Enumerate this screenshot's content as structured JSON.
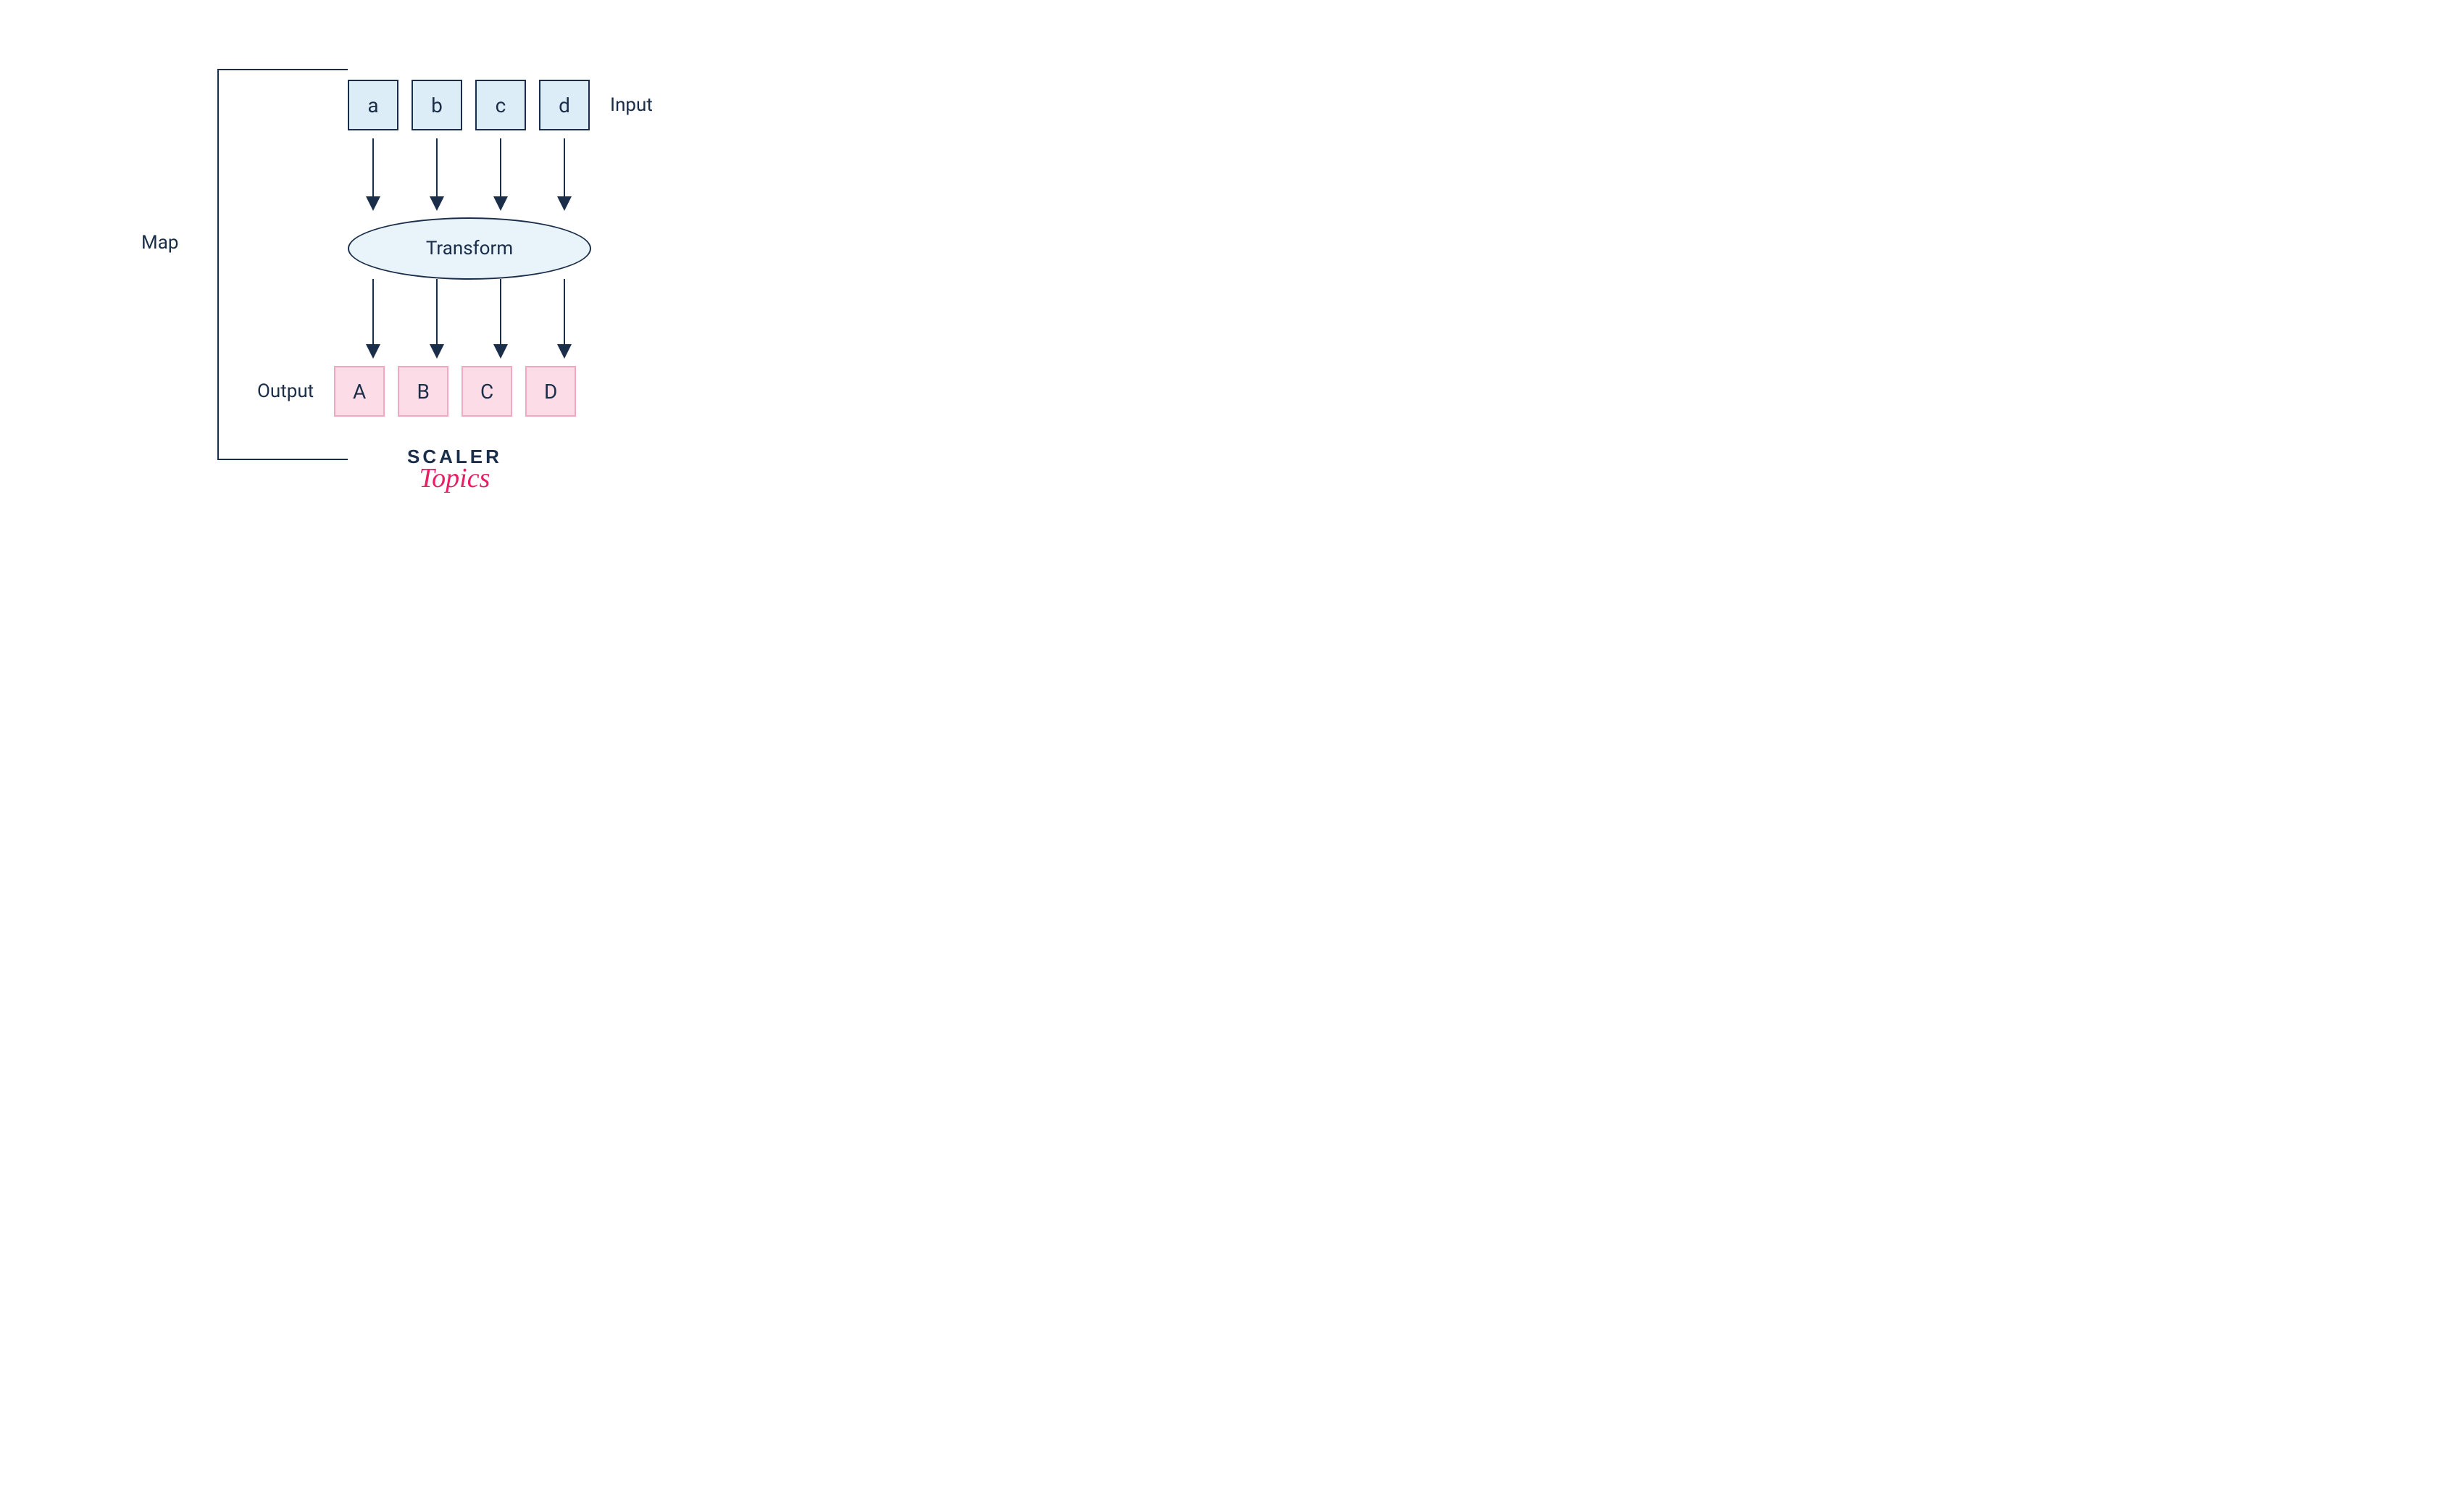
{
  "diagram": {
    "map_label": "Map",
    "input_label": "Input",
    "output_label": "Output",
    "transform_label": "Transform",
    "inputs": [
      "a",
      "b",
      "c",
      "d"
    ],
    "outputs": [
      "A",
      "B",
      "C",
      "D"
    ]
  },
  "logo": {
    "line1": "SCALER",
    "line2": "Topics"
  },
  "colors": {
    "input_fill": "#dcedf7",
    "input_border": "#1a2e4a",
    "output_fill": "#fbdce7",
    "output_border": "#f1a8c3",
    "transform_fill": "#e8f3fa",
    "text": "#1a2e4a",
    "accent": "#e91e63"
  }
}
